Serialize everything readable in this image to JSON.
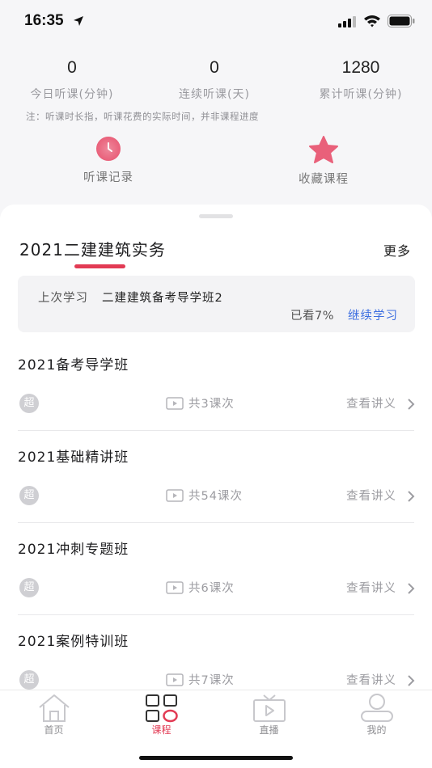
{
  "status_bar": {
    "time": "16:35"
  },
  "stats": {
    "today": {
      "value": "0",
      "label": "今日听课(分钟)"
    },
    "streak": {
      "value": "0",
      "label": "连续听课(天)"
    },
    "total": {
      "value": "1280",
      "label": "累计听课(分钟)"
    },
    "note": "注：听课时长指，听课花费的实际时间，并非课程进度"
  },
  "shortcuts": {
    "history": {
      "label": "听课记录",
      "icon": "clock-icon",
      "color": "#e9607a"
    },
    "favorites": {
      "label": "收藏课程",
      "icon": "star-icon",
      "color": "#e9607a"
    }
  },
  "course": {
    "title": "2021二建建筑实务",
    "more": "更多",
    "accent": "#e23b54"
  },
  "last_study": {
    "label": "上次学习",
    "name": "二建建筑备考导学班2",
    "watched": "已看7%",
    "continue": "继续学习",
    "link_color": "#3d6ee0"
  },
  "classes": [
    {
      "name": "2021备考导学班",
      "badge": "超",
      "lessons": "共3课次",
      "handout": "查看讲义"
    },
    {
      "name": "2021基础精讲班",
      "badge": "超",
      "lessons": "共54课次",
      "handout": "查看讲义"
    },
    {
      "name": "2021冲刺专题班",
      "badge": "超",
      "lessons": "共6课次",
      "handout": "查看讲义"
    },
    {
      "name": "2021案例特训班",
      "badge": "超",
      "lessons": "共7课次",
      "handout": "查看讲义"
    }
  ],
  "tabs": [
    {
      "label": "首页",
      "icon": "home-icon",
      "active": false
    },
    {
      "label": "课程",
      "icon": "course-grid-icon",
      "active": true
    },
    {
      "label": "直播",
      "icon": "tv-icon",
      "active": false
    },
    {
      "label": "我的",
      "icon": "profile-icon",
      "active": false
    }
  ]
}
